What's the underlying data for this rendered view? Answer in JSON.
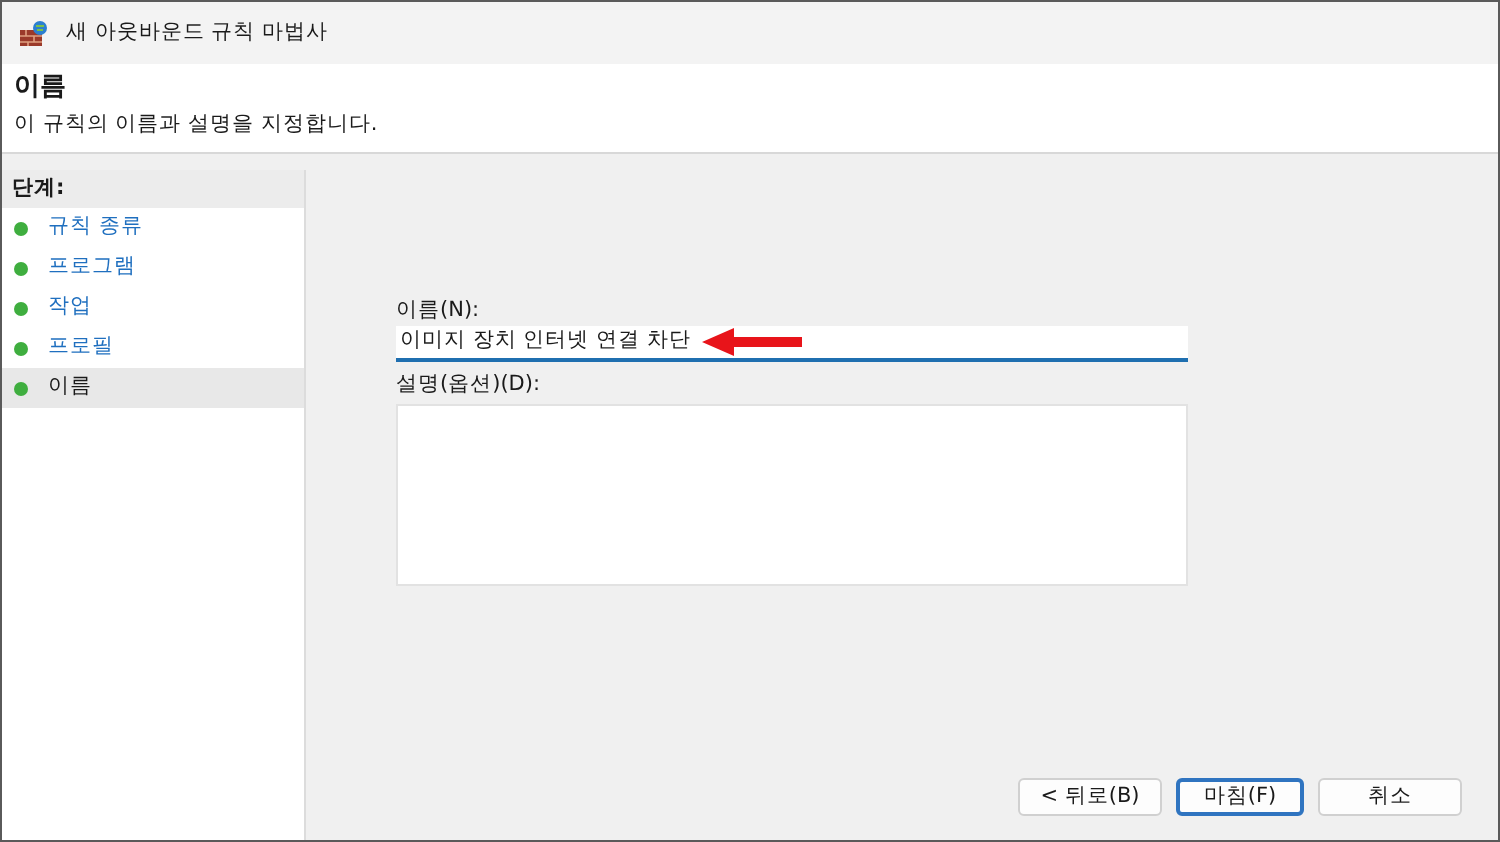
{
  "window": {
    "title": "새 아웃바운드 규칙 마법사"
  },
  "header": {
    "title": "이름",
    "subtitle": "이 규칙의 이름과 설명을 지정합니다."
  },
  "steps": {
    "heading": "단계:",
    "items": [
      {
        "label": "규칙 종류",
        "selected": false
      },
      {
        "label": "프로그램",
        "selected": false
      },
      {
        "label": "작업",
        "selected": false
      },
      {
        "label": "프로필",
        "selected": false
      },
      {
        "label": "이름",
        "selected": true
      }
    ]
  },
  "form": {
    "name_label": "이름(N):",
    "name_value": "이미지 장치 인터넷 연결 차단",
    "description_label": "설명(옵션)(D):"
  },
  "buttons": [
    {
      "label": "< 뒤로(B)",
      "default": false
    },
    {
      "label": "마침(F)",
      "default": true
    },
    {
      "label": "취소",
      "default": false
    }
  ]
}
